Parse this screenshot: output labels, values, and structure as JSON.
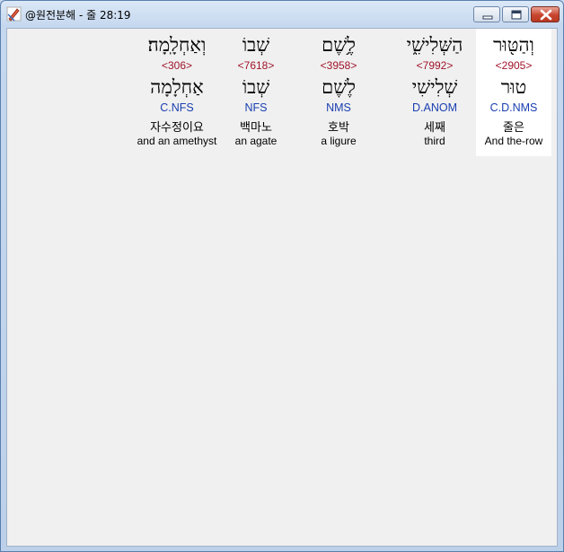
{
  "window": {
    "title": "@원전분해 - 줄 28:19",
    "icon": "pencil-ruler-icon",
    "controls": {
      "minimize": "minimize-icon",
      "maximize": "maximize-icon",
      "close": "close-icon"
    }
  },
  "words": [
    {
      "hebrew": "וְאַחְלָֽמָה׃",
      "strongs": "<306>",
      "lemma": "אַחְלָמָה",
      "morph": "C.NFS",
      "korean": "자수정이요",
      "english": "and an amethyst",
      "highlighted": false
    },
    {
      "hebrew": "שְׁבוֹ",
      "strongs": "<7618>",
      "lemma": "שְׁבוֹ",
      "morph": "NFS",
      "korean": "백마노",
      "english": "an agate",
      "highlighted": false
    },
    {
      "hebrew": "לֶ֥שֶׁם",
      "strongs": "<3958>",
      "lemma": "לֶשֶׁם",
      "morph": "NMS",
      "korean": "호박",
      "english": "a ligure",
      "highlighted": false
    },
    {
      "hebrew": "הַשְּׁלִישִׁ֑י",
      "strongs": "<7992>",
      "lemma": "שְׁלִישִׁי",
      "morph": "D.ANOM",
      "korean": "세째",
      "english": "third",
      "highlighted": false
    },
    {
      "hebrew": "וְהַטּ֖וּר",
      "strongs": "<2905>",
      "lemma": "טוּר",
      "morph": "C.D.NMS",
      "korean": "줄은",
      "english": "And the-row",
      "highlighted": true
    }
  ],
  "colors": {
    "strongs": "#a0142a",
    "morph": "#1a3fb0",
    "highlight": "#ffffff",
    "client_bg": "#f0f0f0"
  }
}
